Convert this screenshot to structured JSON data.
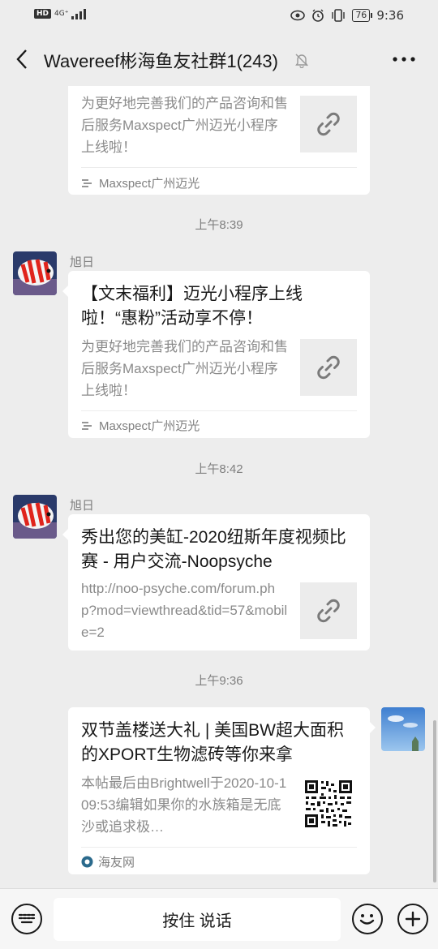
{
  "status_bar": {
    "hd": "HD",
    "network": "4G⁺",
    "battery": "76",
    "time": "9:36"
  },
  "header": {
    "title": "Wavereef彬海鱼友社群1(243)"
  },
  "messages": [
    {
      "type": "link-card",
      "title": "",
      "desc": "为更好地完善我们的产品咨询和售后服务Maxspect广州迈光小程序上线啦！",
      "source": "Maxspect广州迈光"
    },
    {
      "type": "time",
      "text": "上午8:39"
    },
    {
      "type": "link-card",
      "sender": "旭日",
      "title": "【文末福利】迈光小程序上线啦！“惠粉”活动享不停！",
      "desc": "为更好地完善我们的产品咨询和售后服务Maxspect广州迈光小程序上线啦！",
      "source": "Maxspect广州迈光"
    },
    {
      "type": "time",
      "text": "上午8:42"
    },
    {
      "type": "link-card",
      "sender": "旭日",
      "title": "秀出您的美缸-2020纽斯年度视频比赛 - 用户交流-Noopsyche",
      "desc": "http://noo-psyche.com/forum.php?mod=viewthread&tid=57&mobile=2"
    },
    {
      "type": "time",
      "text": "上午9:36"
    },
    {
      "type": "link-card",
      "title": "双节盖楼送大礼 | 美国BW超大面积的XPORT生物滤砖等你来拿",
      "desc": "本帖最后由Brightwell于2020-10-109:53编辑如果你的水族箱是无底沙或追求极…",
      "source": "海友网"
    }
  ],
  "input_bar": {
    "hold_to_talk": "按住 说话"
  },
  "icons": {
    "back": "chevron-left-icon",
    "mute": "bell-off-icon",
    "more": "more-dots-icon",
    "link": "link-icon",
    "voice": "keyboard-icon",
    "emoji": "smiley-icon",
    "plus": "plus-icon"
  }
}
